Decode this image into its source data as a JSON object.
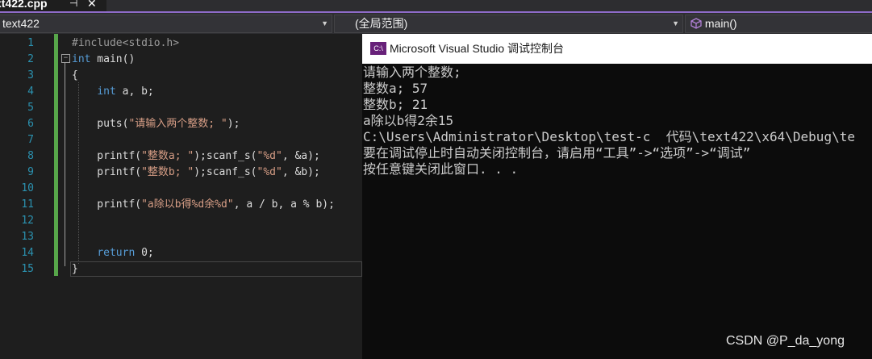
{
  "tab": {
    "name": "xt422.cpp",
    "pin_glyph": "⊣",
    "close_glyph": "✕"
  },
  "navbar": {
    "project": "text422",
    "scope": "(全局范围)",
    "member": "main()"
  },
  "editor": {
    "line_numbers": [
      "1",
      "2",
      "3",
      "4",
      "5",
      "6",
      "7",
      "8",
      "9",
      "10",
      "11",
      "12",
      "13",
      "14",
      "15"
    ],
    "lines": [
      [
        {
          "t": "#include<stdio.h>",
          "c": "pp"
        }
      ],
      [
        {
          "t": "int",
          "c": "kw"
        },
        {
          "t": " main()",
          "c": ""
        }
      ],
      [
        {
          "t": "{",
          "c": ""
        }
      ],
      [
        {
          "t": "    ",
          "c": ""
        },
        {
          "t": "int",
          "c": "kw"
        },
        {
          "t": " a, b;",
          "c": ""
        }
      ],
      [],
      [
        {
          "t": "    puts(",
          "c": ""
        },
        {
          "t": "\"请输入两个整数; \"",
          "c": "str"
        },
        {
          "t": ");",
          "c": ""
        }
      ],
      [],
      [
        {
          "t": "    printf(",
          "c": ""
        },
        {
          "t": "\"整数a; \"",
          "c": "str"
        },
        {
          "t": ");scanf_s(",
          "c": ""
        },
        {
          "t": "\"%d\"",
          "c": "str"
        },
        {
          "t": ", &a);",
          "c": ""
        }
      ],
      [
        {
          "t": "    printf(",
          "c": ""
        },
        {
          "t": "\"整数b; \"",
          "c": "str"
        },
        {
          "t": ");scanf_s(",
          "c": ""
        },
        {
          "t": "\"%d\"",
          "c": "str"
        },
        {
          "t": ", &b);",
          "c": ""
        }
      ],
      [],
      [
        {
          "t": "    printf(",
          "c": ""
        },
        {
          "t": "\"a除以b得%d余%d\"",
          "c": "str"
        },
        {
          "t": ", a / b, a % b);",
          "c": ""
        }
      ],
      [],
      [],
      [
        {
          "t": "    ",
          "c": ""
        },
        {
          "t": "return",
          "c": "kw"
        },
        {
          "t": " 0;",
          "c": ""
        }
      ],
      [
        {
          "t": "}",
          "c": ""
        }
      ]
    ],
    "colors": {
      "keyword": "#569cd6",
      "string": "#d69d85",
      "preprocessor": "#9b9b9b",
      "line_number": "#2b91af",
      "change_bar": "#57a64a"
    }
  },
  "console": {
    "icon_text": "C:\\",
    "title": "Microsoft Visual Studio 调试控制台",
    "lines": [
      "请输入两个整数;",
      "整数a; 57",
      "整数b; 21",
      "a除以b得2余15",
      "C:\\Users\\Administrator\\Desktop\\test-c  代码\\text422\\x64\\Debug\\te",
      "要在调试停止时自动关闭控制台，请启用“工具”->“选项”->“调试”",
      "按任意键关闭此窗口. . ."
    ]
  },
  "watermark": "CSDN @P_da_yong"
}
